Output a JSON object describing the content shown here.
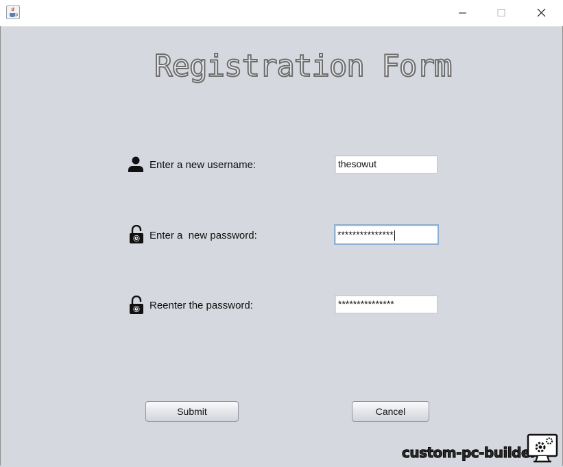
{
  "window": {
    "icon": "java-cup-icon",
    "controls": [
      "minimize-icon",
      "maximize-icon",
      "close-icon"
    ]
  },
  "form": {
    "title": "Registration Form",
    "username": {
      "icon": "user-icon",
      "label": "Enter a new username:",
      "value": "thesowut"
    },
    "password": {
      "icon": "lock-icon",
      "label": "Enter a  new password:",
      "value": "***************"
    },
    "confirm": {
      "icon": "lock-icon",
      "label": "Reenter the password:",
      "value": "***************"
    },
    "submit_label": "Submit",
    "cancel_label": "Cancel"
  },
  "watermark": {
    "text": "custom-pc-builder",
    "icon": "pc-builder-logo-icon"
  }
}
